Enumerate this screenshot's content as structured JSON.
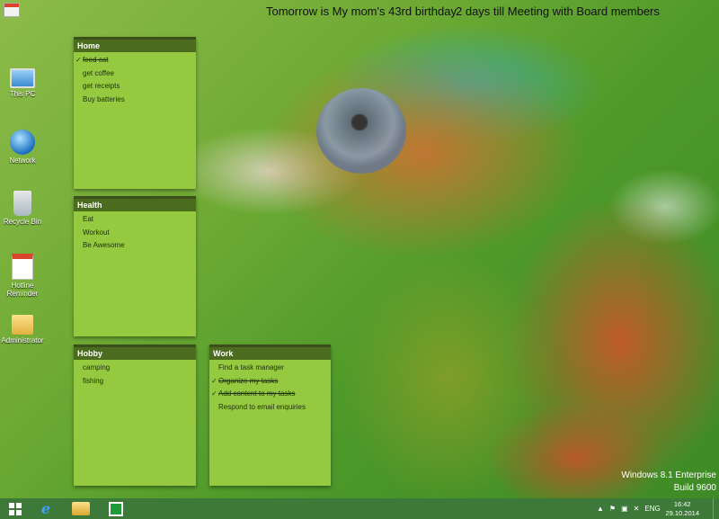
{
  "banner": {
    "reminder_1": "Tomorrow is My mom's 43rd birthday",
    "reminder_2": "2 days till Meeting with Board members"
  },
  "desktop_icons": [
    {
      "label": "This PC",
      "icon": "computer-icon"
    },
    {
      "label": "Network",
      "icon": "network-icon"
    },
    {
      "label": "Recycle Bin",
      "icon": "recycle-bin-icon"
    },
    {
      "label": "Hotline Reminder",
      "icon": "calendar-icon"
    },
    {
      "label": "Administrator",
      "icon": "user-folder-icon"
    }
  ],
  "notes": {
    "home": {
      "title": "Home",
      "items": [
        {
          "text": "feed cat",
          "done": true
        },
        {
          "text": "get coffee",
          "done": false
        },
        {
          "text": "get receipts",
          "done": false
        },
        {
          "text": "Buy batteries",
          "done": false
        }
      ]
    },
    "health": {
      "title": "Health",
      "items": [
        {
          "text": "Eat",
          "done": false
        },
        {
          "text": "Workout",
          "done": false
        },
        {
          "text": "Be Awesome",
          "done": false
        }
      ]
    },
    "hobby": {
      "title": "Hobby",
      "items": [
        {
          "text": "camping",
          "done": false
        },
        {
          "text": "fishing",
          "done": false
        }
      ]
    },
    "work": {
      "title": "Work",
      "items": [
        {
          "text": "Find a task manager",
          "done": false
        },
        {
          "text": "Organize my tasks",
          "done": true
        },
        {
          "text": "Add content to my tasks",
          "done": true
        },
        {
          "text": "Respond to email enquiries",
          "done": false
        }
      ]
    }
  },
  "watermark": {
    "line1": "Windows 8.1 Enterprise",
    "line2": "Build 9600"
  },
  "taskbar": {
    "pinned": [
      "start-icon",
      "internet-explorer-icon",
      "file-explorer-icon",
      "store-icon"
    ],
    "language": "ENG",
    "time": "16:42",
    "date": "29.10.2014"
  },
  "colors": {
    "note_body": "#94c940",
    "note_header": "#4b6b1e",
    "taskbar": "#3d7a3a"
  }
}
